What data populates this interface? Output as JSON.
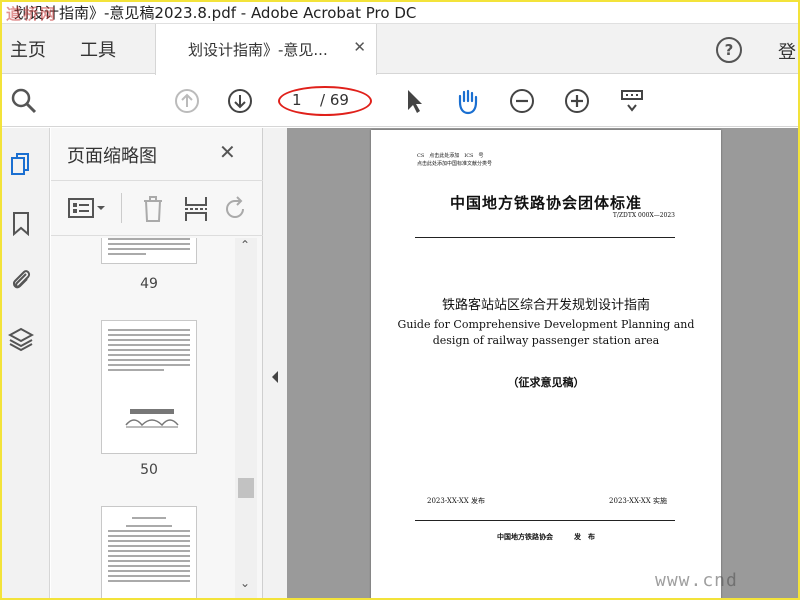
{
  "window": {
    "title": "划设计指南》-意见稿2023.8.pdf - Adobe Acrobat Pro DC",
    "logo_text": "道桥网",
    "controls": [
      "—",
      "☐",
      "✕"
    ]
  },
  "menubar": {
    "home": "主页",
    "tools": "工具",
    "tab_label": "划设计指南》-意见...",
    "tab_close": "✕",
    "help": "?",
    "sign_in": "登"
  },
  "toolbar": {
    "current_page": "1",
    "total_pages": "/ 69",
    "accent": "#e0201a"
  },
  "panel": {
    "title": "页面缩略图",
    "close": "✕",
    "thumbnails": [
      {
        "label": "49"
      },
      {
        "label": "50"
      },
      {
        "label": ""
      }
    ]
  },
  "document": {
    "cs_line": "CS　点击此处添加　ICS　号",
    "ics_line": "点击此处添加中国标准文献分类号",
    "org_title": "中国地方铁路协会团体标准",
    "std_no": "T/ZDTX 000X—2023",
    "title_cn": "铁路客站站区综合开发规划设计指南",
    "title_en_1": "Guide for Comprehensive Development Planning and",
    "title_en_2": "design of railway passenger station area",
    "draft": "（征求意见稿）",
    "issue_date": "2023-XX-XX 发布",
    "impl_date": "2023-XX-XX 实施",
    "publisher": "中国地方铁路协会　　　发　布"
  },
  "watermark": "www.cnd"
}
